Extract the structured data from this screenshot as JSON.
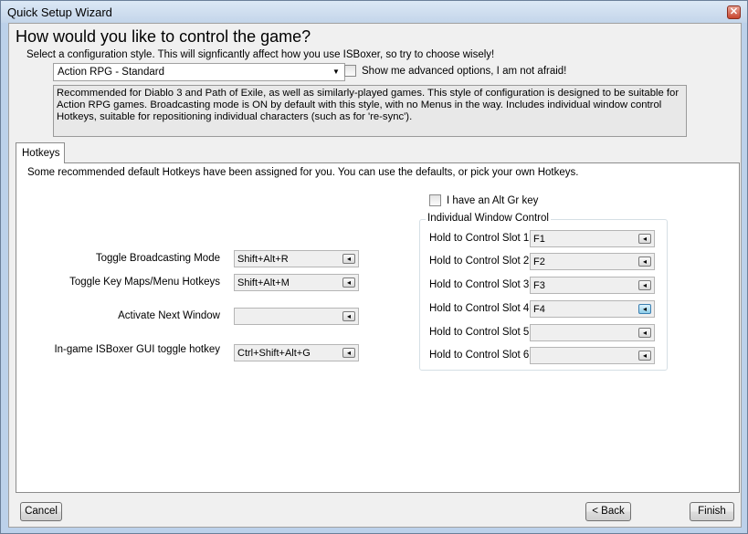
{
  "window": {
    "title": "Quick Setup Wizard",
    "close_glyph": "✕"
  },
  "header": {
    "heading": "How would you like to control the game?",
    "subtitle": "Select a configuration style. This will signficantly affect how you use ISBoxer, so try to choose wisely!"
  },
  "style_select": {
    "value": "Action RPG - Standard",
    "arrow_icon": "chevron-down-icon"
  },
  "advanced_option": {
    "label": "Show me advanced options, I am not afraid!",
    "checked": false
  },
  "description": "Recommended for Diablo 3 and Path of Exile, as well as similarly-played games. This style of configuration is designed to be suitable for Action RPG games. Broadcasting mode is ON by default with this style, with no Menus in the way. Includes individual window control Hotkeys, suitable for repositioning individual characters (such as for 're-sync').",
  "tabs": [
    {
      "label": "Hotkeys"
    }
  ],
  "hotkeys_panel": {
    "intro": "Some recommended default Hotkeys have been assigned for you. You can use the defaults, or pick your own Hotkeys.",
    "altgr": {
      "label": "I have an Alt Gr key",
      "checked": false
    },
    "hotkeys": [
      {
        "label": "Toggle Broadcasting Mode",
        "value": "Shift+Alt+R"
      },
      {
        "label": "Toggle Key Maps/Menu Hotkeys",
        "value": "Shift+Alt+M"
      },
      {
        "label": "Activate Next Window",
        "value": ""
      },
      {
        "label": "In-game ISBoxer GUI toggle hotkey",
        "value": "Ctrl+Shift+Alt+G"
      }
    ],
    "window_control": {
      "title": "Individual Window Control",
      "slots": [
        {
          "label": "Hold to Control Slot 1",
          "value": "F1"
        },
        {
          "label": "Hold to Control Slot 2",
          "value": "F2"
        },
        {
          "label": "Hold to Control Slot 3",
          "value": "F3"
        },
        {
          "label": "Hold to Control Slot 4",
          "value": "F4"
        },
        {
          "label": "Hold to Control Slot 5",
          "value": ""
        },
        {
          "label": "Hold to Control Slot 6",
          "value": ""
        }
      ]
    },
    "clear_button_glyph": "◂"
  },
  "footer": {
    "cancel": "Cancel",
    "back": "< Back",
    "finish": "Finish"
  }
}
